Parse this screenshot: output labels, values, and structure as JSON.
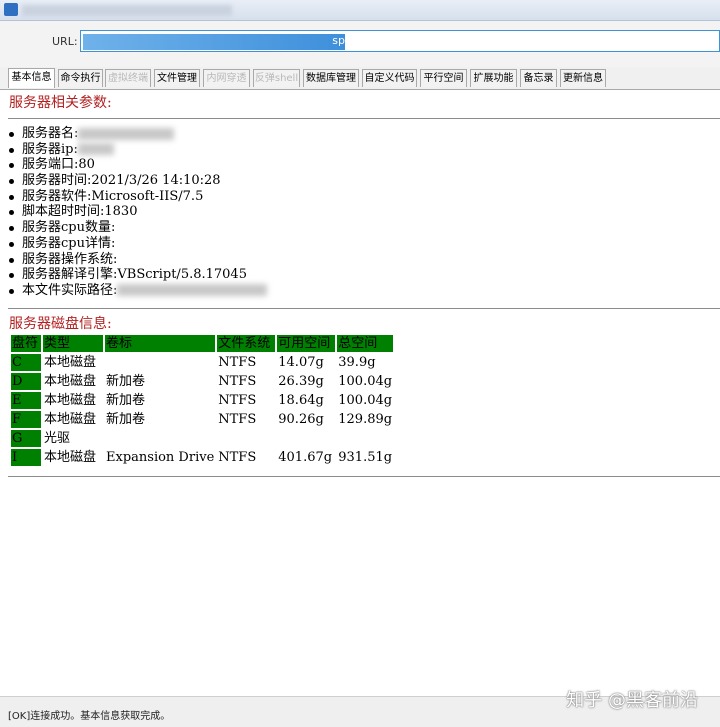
{
  "url": {
    "label": "URL:",
    "value_suffix": "sp"
  },
  "tabs": [
    {
      "label": "基本信息",
      "state": "active"
    },
    {
      "label": "命令执行",
      "state": "normal"
    },
    {
      "label": "虚拟终端",
      "state": "disabled"
    },
    {
      "label": "文件管理",
      "state": "normal"
    },
    {
      "label": "内网穿透",
      "state": "disabled"
    },
    {
      "label": "反弹shell",
      "state": "disabled"
    },
    {
      "label": "数据库管理",
      "state": "normal"
    },
    {
      "label": "自定义代码",
      "state": "normal"
    },
    {
      "label": "平行空间",
      "state": "normal"
    },
    {
      "label": "扩展功能",
      "state": "normal"
    },
    {
      "label": "备忘录",
      "state": "normal"
    },
    {
      "label": "更新信息",
      "state": "normal"
    }
  ],
  "server": {
    "title": "服务器相关参数:",
    "items": [
      {
        "label": "服务器名:",
        "value": ""
      },
      {
        "label": "服务器ip:",
        "value": ""
      },
      {
        "label": "服务端口:",
        "value": "80"
      },
      {
        "label": "服务器时间:",
        "value": "2021/3/26 14:10:28"
      },
      {
        "label": "服务器软件:",
        "value": "Microsoft-IIS/7.5"
      },
      {
        "label": "脚本超时时间:",
        "value": "1830"
      },
      {
        "label": "服务器cpu数量:",
        "value": ""
      },
      {
        "label": "服务器cpu详情:",
        "value": ""
      },
      {
        "label": "服务器操作系统:",
        "value": ""
      },
      {
        "label": "服务器解译引擎:",
        "value": "VBScript/5.8.17045"
      },
      {
        "label": "本文件实际路径:",
        "value": ""
      }
    ]
  },
  "disk": {
    "title": "服务器磁盘信息:",
    "headers": [
      "盘符",
      "类型",
      "卷标",
      "文件系统",
      "可用空间",
      "总空间"
    ],
    "rows": [
      [
        "C",
        "本地磁盘",
        "",
        "NTFS",
        "14.07g",
        "39.9g"
      ],
      [
        "D",
        "本地磁盘",
        "新加卷",
        "NTFS",
        "26.39g",
        "100.04g"
      ],
      [
        "E",
        "本地磁盘",
        "新加卷",
        "NTFS",
        "18.64g",
        "100.04g"
      ],
      [
        "F",
        "本地磁盘",
        "新加卷",
        "NTFS",
        "90.26g",
        "129.89g"
      ],
      [
        "G",
        "光驱",
        "",
        "",
        "",
        ""
      ],
      [
        "I",
        "本地磁盘",
        "Expansion Drive",
        "NTFS",
        "401.67g",
        "931.51g"
      ]
    ]
  },
  "status": "[OK]连接成功。基本信息获取完成。",
  "watermark": "知乎 @黑客前沿",
  "colors": {
    "section_title": "#b22222",
    "table_header": "#008000",
    "url_selection": "#3d8fdc"
  }
}
